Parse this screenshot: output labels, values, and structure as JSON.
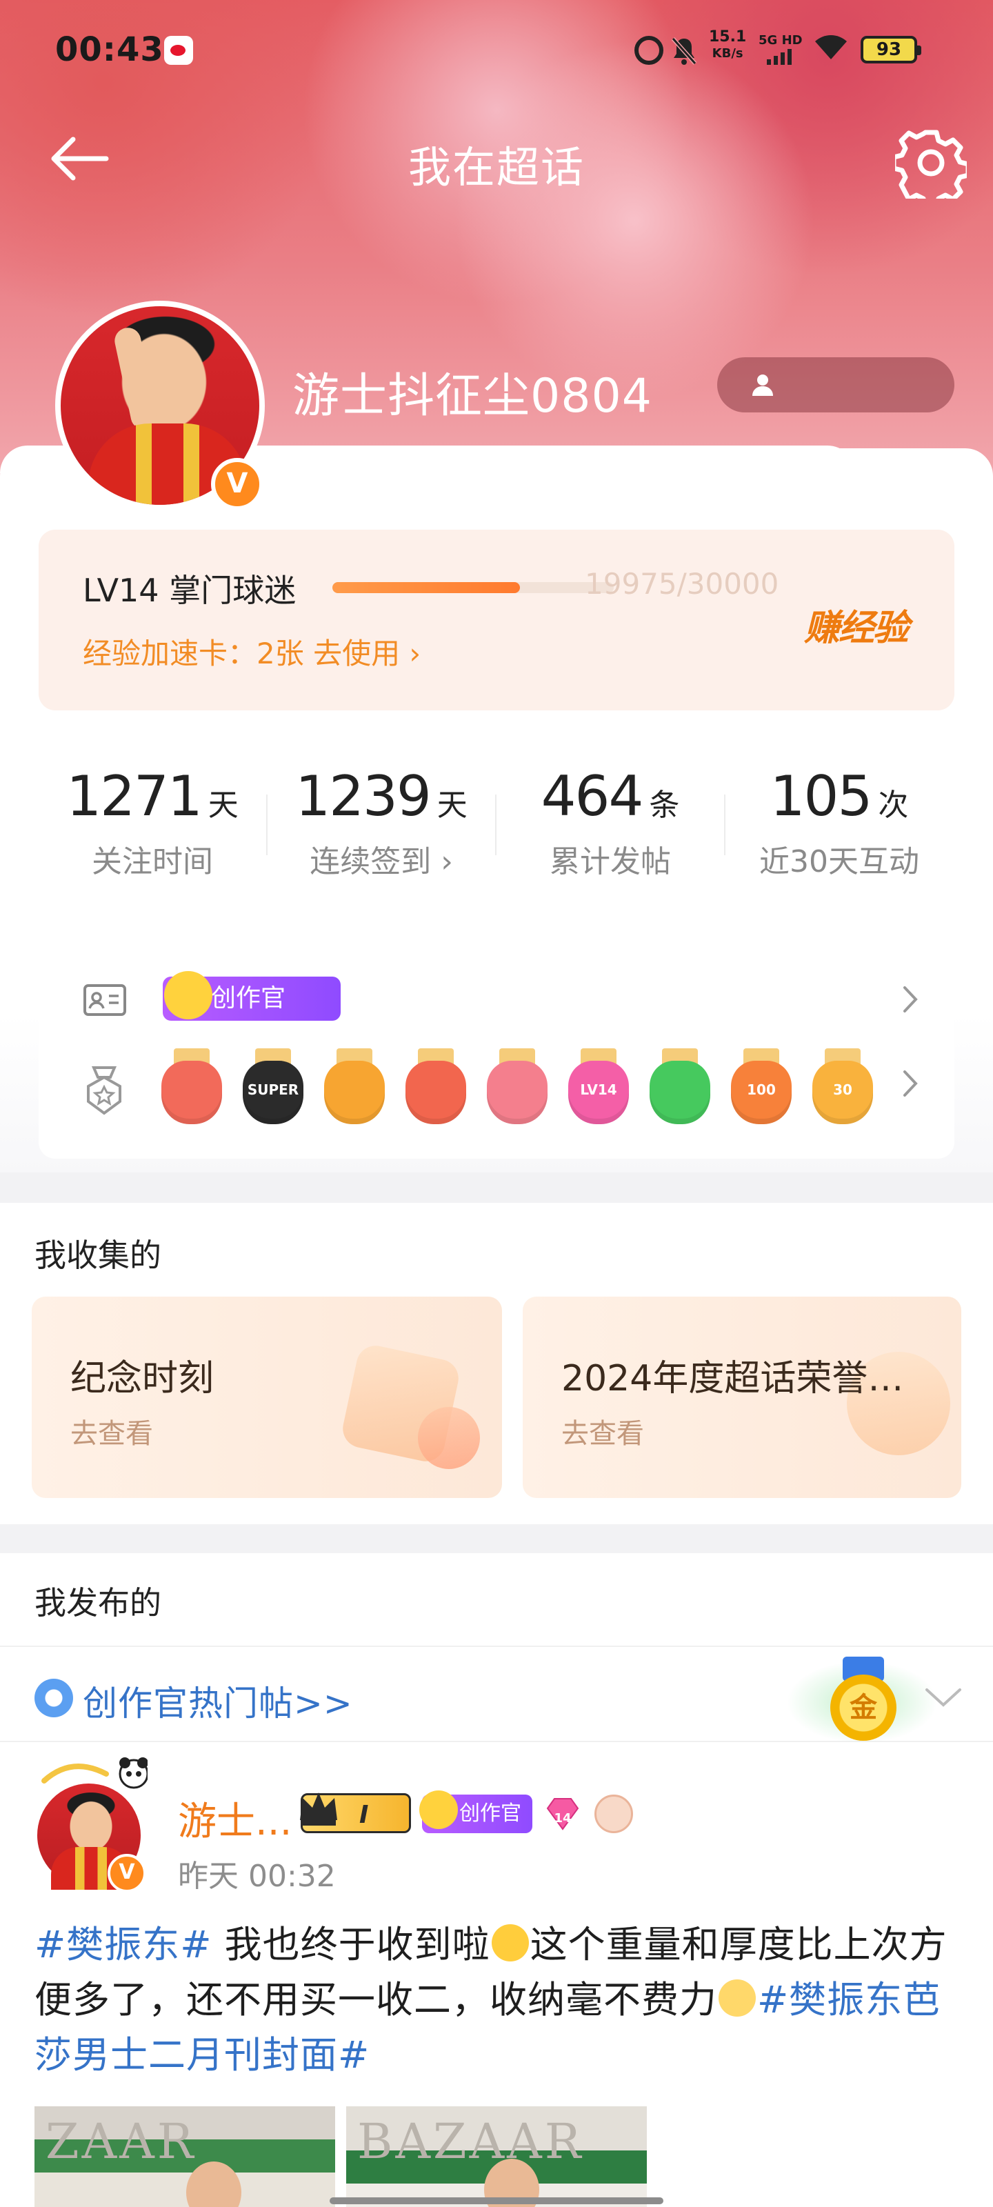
{
  "status_bar": {
    "time": "00:43",
    "net_speed_value": "15.1",
    "net_speed_unit": "KB/s",
    "signal_label": "5G HD",
    "battery": "93"
  },
  "header": {
    "title": "我在超话"
  },
  "profile": {
    "username": "游士抖征尘0804",
    "verified_mark": "V"
  },
  "level": {
    "name": "LV14 掌门球迷",
    "progress_text": "19975/30000",
    "progress_fraction": 0.6658,
    "boost_text": "经验加速卡：2张 去使用 ›",
    "earn_label": "赚经验"
  },
  "stats": [
    {
      "value": "1271",
      "unit": "天",
      "label": "关注时间"
    },
    {
      "value": "1239",
      "unit": "天",
      "label": "连续签到 ›"
    },
    {
      "value": "464",
      "unit": "条",
      "label": "累计发帖"
    },
    {
      "value": "105",
      "unit": "次",
      "label": "近30天互动"
    }
  ],
  "badges": {
    "creator_tag": "创作官",
    "medals": [
      {
        "color": "#f26a5a",
        "text": ""
      },
      {
        "color": "#2b2b2b",
        "text": "SUPER"
      },
      {
        "color": "#f7a531",
        "text": ""
      },
      {
        "color": "#f2664e",
        "text": ""
      },
      {
        "color": "#f47f8d",
        "text": ""
      },
      {
        "color": "#f45fa7",
        "text": "LV14"
      },
      {
        "color": "#46c95e",
        "text": ""
      },
      {
        "color": "#f7813a",
        "text": "100"
      },
      {
        "color": "#f9b23d",
        "text": "30"
      }
    ]
  },
  "collected": {
    "title": "我收集的",
    "cards": [
      {
        "title": "纪念时刻",
        "sub": "去查看"
      },
      {
        "title": "2024年度超话荣誉…",
        "sub": "去查看"
      }
    ]
  },
  "published": {
    "title": "我发布的",
    "hot_link": "创作官热门帖>>",
    "gold_medal_text": "金"
  },
  "post": {
    "author": "游士...",
    "crown_level": "I",
    "creator_tag": "创作官",
    "gem_level": "14",
    "time": "昨天 00:32",
    "topic1": "#樊振东#",
    "text1": " 我也终于收到啦",
    "text2": "这个重量和厚度比上次方便多了，还不用买一收二，收纳毫不费力",
    "topic2": "#樊振东芭莎男士二月刊封面#",
    "thumb1_mag": "ZAAR",
    "thumb2_mag": "BAZAAR"
  },
  "colors": {
    "accent_orange": "#f28c25",
    "topic_blue": "#3573c8",
    "hero_red": "#e45d63"
  }
}
